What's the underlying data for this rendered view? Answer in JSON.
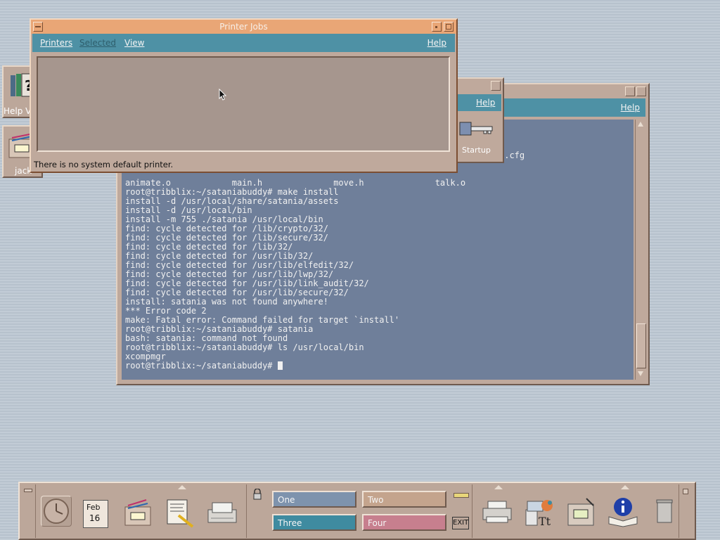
{
  "printer_jobs": {
    "title": "Printer Jobs",
    "menus": [
      "Printers",
      "Selected",
      "View",
      "Help"
    ],
    "status": "There is no system default printer."
  },
  "help_manager": {
    "help_label": "Help",
    "startup_label": "Startup"
  },
  "terminal": {
    "help_label": "Help",
    "partial_lines": [
      {
        "text": "e.cfg"
      },
      {
        "text": "animate.o            main.h              move.h              talk.o"
      }
    ],
    "lines": [
      "root@tribblix:~/sataniabuddy# make install",
      "install -d /usr/local/share/satania/assets",
      "install -d /usr/local/bin",
      "install -m 755 ./satania /usr/local/bin",
      "find: cycle detected for /lib/crypto/32/",
      "find: cycle detected for /lib/secure/32/",
      "find: cycle detected for /lib/32/",
      "find: cycle detected for /usr/lib/32/",
      "find: cycle detected for /usr/lib/elfedit/32/",
      "find: cycle detected for /usr/lib/lwp/32/",
      "find: cycle detected for /usr/lib/link_audit/32/",
      "find: cycle detected for /usr/lib/secure/32/",
      "install: satania was not found anywhere!",
      "*** Error code 2",
      "make: Fatal error: Command failed for target `install'",
      "root@tribblix:~/sataniabuddy# satania",
      "bash: satania: command not found",
      "root@tribblix:~/sataniabuddy# ls /usr/local/bin",
      "xcompmgr",
      "root@tribblix:~/sataniabuddy# "
    ]
  },
  "desktop_icons": {
    "help_viewer_label": "Help V",
    "jack_label": "jack"
  },
  "front_panel": {
    "date_month": "Feb",
    "date_day": "16",
    "workspaces": [
      "One",
      "Two",
      "Three",
      "Four"
    ],
    "exit_label": "EXIT"
  },
  "colors": {
    "titlebar_active": "#e9a676",
    "menubar": "#4e91a5",
    "terminal_bg": "#6f7f9a",
    "window_frame": "#bfa99c",
    "ws_one": "#7e93ad",
    "ws_two": "#c4a48d",
    "ws_three": "#3f8ba0",
    "ws_four": "#c77f8e"
  }
}
